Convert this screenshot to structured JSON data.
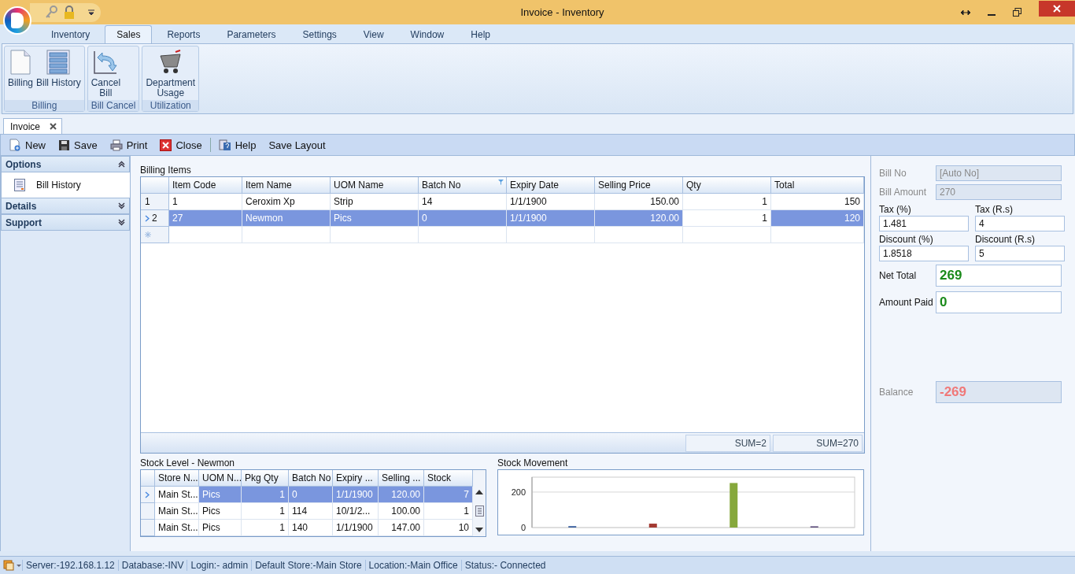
{
  "window": {
    "title": "Invoice - Inventory"
  },
  "ribbon_tabs": [
    {
      "label": "Inventory",
      "selected": false
    },
    {
      "label": "Sales",
      "selected": true
    },
    {
      "label": "Reports",
      "selected": false
    },
    {
      "label": "Parameters",
      "selected": false
    },
    {
      "label": "Settings",
      "selected": false
    },
    {
      "label": "View",
      "selected": false
    },
    {
      "label": "Window",
      "selected": false
    },
    {
      "label": "Help",
      "selected": false
    }
  ],
  "ribbon_groups": [
    {
      "label": "Billing",
      "buttons": [
        {
          "label": "Billing",
          "kind": "page"
        },
        {
          "label": "Bill History",
          "kind": "list"
        }
      ]
    },
    {
      "label": "Bill Cancel",
      "buttons": [
        {
          "label": "Cancel\nBill",
          "kind": "undo"
        }
      ]
    },
    {
      "label": "Utilization",
      "buttons": [
        {
          "label": "Department\nUsage",
          "kind": "cart"
        }
      ]
    }
  ],
  "document_tab": {
    "label": "Invoice"
  },
  "toolbar": [
    {
      "label": "New",
      "kind": "new"
    },
    {
      "label": "Save",
      "kind": "save"
    },
    {
      "label": "Print",
      "kind": "print"
    },
    {
      "label": "Close",
      "kind": "close"
    },
    {
      "label": "Help",
      "kind": "help"
    },
    {
      "label": "Save Layout",
      "kind": "text"
    }
  ],
  "sidebar": [
    {
      "label": "Options",
      "expanded": true,
      "items": [
        "Bill History"
      ]
    },
    {
      "label": "Details",
      "expanded": false
    },
    {
      "label": "Support",
      "expanded": false
    }
  ],
  "billing_items": {
    "title": "Billing Items",
    "columns": [
      "Item Code",
      "Item Name",
      "UOM Name",
      "Batch No",
      "Expiry Date",
      "Selling Price",
      "Qty",
      "Total"
    ],
    "rows": [
      {
        "number": "1",
        "selected": false,
        "cells": [
          {
            "text": "1",
            "focused": false
          },
          {
            "text": "Ceroxim Xp",
            "focused": false
          },
          {
            "text": "Strip",
            "focused": false
          },
          {
            "text": "14",
            "focused": false
          },
          {
            "text": "1/1/1900",
            "focused": false
          },
          {
            "text": "150.00",
            "focused": false
          },
          {
            "text": "1",
            "focused": false
          },
          {
            "text": "150",
            "focused": false
          }
        ]
      },
      {
        "number": "2",
        "selected": true,
        "cells": [
          {
            "text": "27",
            "focused": false
          },
          {
            "text": "Newmon",
            "focused": false
          },
          {
            "text": "Pics",
            "focused": false
          },
          {
            "text": "0",
            "focused": false
          },
          {
            "text": "1/1/1900",
            "focused": false
          },
          {
            "text": "120.00",
            "focused": false
          },
          {
            "text": "1",
            "focused": true
          },
          {
            "text": "120",
            "focused": false
          }
        ]
      }
    ],
    "footer": {
      "qty": "SUM=2",
      "total": "SUM=270"
    }
  },
  "stock_level": {
    "title": "Stock Level - Newmon",
    "columns": [
      "Store N...",
      "UOM N...",
      "Pkg Qty",
      "Batch No",
      "Expiry ...",
      "Selling ...",
      "Stock"
    ],
    "rows": [
      {
        "selected": true,
        "cells": [
          {
            "text": "Main St...",
            "focused": true
          },
          {
            "text": "Pics",
            "focused": false
          },
          {
            "text": "1",
            "focused": false
          },
          {
            "text": "0",
            "focused": false
          },
          {
            "text": "1/1/1900",
            "focused": false
          },
          {
            "text": "120.00",
            "focused": false
          },
          {
            "text": "7",
            "focused": false
          }
        ]
      },
      {
        "selected": false,
        "cells": [
          {
            "text": "Main St...",
            "focused": false
          },
          {
            "text": "Pics",
            "focused": false
          },
          {
            "text": "1",
            "focused": false
          },
          {
            "text": "114",
            "focused": false
          },
          {
            "text": "10/1/2...",
            "focused": false
          },
          {
            "text": "100.00",
            "focused": false
          },
          {
            "text": "1",
            "focused": false
          }
        ]
      },
      {
        "selected": false,
        "cells": [
          {
            "text": "Main St...",
            "focused": false
          },
          {
            "text": "Pics",
            "focused": false
          },
          {
            "text": "1",
            "focused": false
          },
          {
            "text": "140",
            "focused": false
          },
          {
            "text": "1/1/1900",
            "focused": false
          },
          {
            "text": "147.00",
            "focused": false
          },
          {
            "text": "10",
            "focused": false
          }
        ]
      }
    ]
  },
  "stock_movement": {
    "title": "Stock Movement",
    "chart_data": {
      "type": "bar",
      "ylim": [
        0,
        284
      ],
      "yticks": [
        0,
        200
      ],
      "series": [
        {
          "color": "#3a5f9e",
          "values": [
            8,
            null,
            null,
            null
          ]
        },
        {
          "color": "#a33a32",
          "values": [
            null,
            22,
            null,
            null
          ]
        },
        {
          "color": "#86a83c",
          "values": [
            null,
            null,
            251,
            null
          ]
        },
        {
          "color": "#5a4a7a",
          "values": [
            null,
            null,
            null,
            7
          ]
        }
      ]
    }
  },
  "bill_fields": [
    {
      "label": "Bill No",
      "value": "[Auto No]",
      "disabled": true,
      "kind": "row"
    },
    {
      "label": "Bill Amount",
      "value": "270",
      "disabled": true,
      "kind": "row"
    }
  ],
  "pair_fields": [
    {
      "label": "Tax (%)",
      "value": "1.481"
    },
    {
      "label": "Tax (R.s)",
      "value": "4"
    },
    {
      "label": "Discount (%)",
      "value": "1.8518"
    },
    {
      "label": "Discount (R.s)",
      "value": "5"
    }
  ],
  "totals": [
    {
      "label": "Net Total",
      "value": "269",
      "disabled": false
    },
    {
      "label": "Amount Paid",
      "value": "0",
      "disabled": false
    }
  ],
  "balance": {
    "label": "Balance",
    "value": "-269",
    "disabled": true
  },
  "status_bar": [
    "Server:-192.168.1.12",
    "Database:-INV",
    "Login:- admin",
    "Default Store:-Main Store",
    "Location:-Main Office",
    "Status:- Connected"
  ]
}
